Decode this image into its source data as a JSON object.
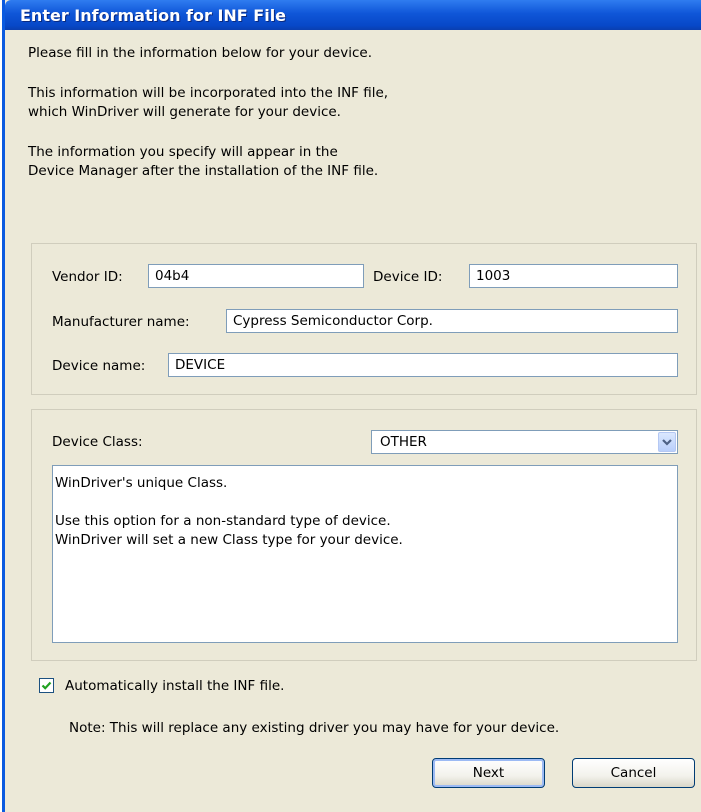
{
  "window": {
    "title": "Enter Information for INF File"
  },
  "intro": {
    "line1": "Please fill in the information below for your device.",
    "line2a": "This information will be incorporated into the INF file,",
    "line2b": "which WinDriver will generate for your device.",
    "line3a": "The information you specify will appear in the",
    "line3b": "Device Manager after the installation of the INF file."
  },
  "fields": {
    "vendor_id_label": "Vendor ID:",
    "vendor_id_value": "04b4",
    "device_id_label": "Device ID:",
    "device_id_value": "1003",
    "manufacturer_label": "Manufacturer name:",
    "manufacturer_value": "Cypress Semiconductor Corp.",
    "device_name_label": "Device name:",
    "device_name_value": "DEVICE"
  },
  "device_class": {
    "label": "Device Class:",
    "selected": "OTHER",
    "description_line1": "WinDriver's unique Class.",
    "description_line2": "Use this option for a non-standard type of device.",
    "description_line3": "WinDriver will set a new Class type for your device."
  },
  "auto_install": {
    "checked": true,
    "label": "Automatically install the INF file.",
    "note": "Note: This will replace any existing driver you may have for your device."
  },
  "buttons": {
    "next": "Next",
    "cancel": "Cancel"
  },
  "colors": {
    "titlebar": "#0f56d8",
    "dialog_bg": "#ece9d8",
    "check": "#21a121"
  },
  "icons": {
    "dropdown": "chevron-down-icon",
    "check": "checkmark-icon"
  }
}
